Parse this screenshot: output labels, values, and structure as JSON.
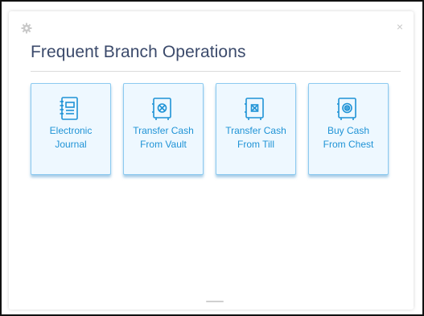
{
  "panel": {
    "title": "Frequent Branch Operations",
    "close_glyph": "×"
  },
  "tiles": [
    {
      "label": "Electronic\nJournal",
      "icon": "journal-icon"
    },
    {
      "label": "Transfer Cash\nFrom Vault",
      "icon": "vault-icon"
    },
    {
      "label": "Transfer Cash\nFrom Till",
      "icon": "till-icon"
    },
    {
      "label": "Buy Cash\nFrom Chest",
      "icon": "chest-icon"
    }
  ],
  "colors": {
    "accent": "#1f93d6",
    "tile_bg": "#eef8ff",
    "tile_border": "#8ccaf0",
    "title": "#3b4a6b"
  }
}
